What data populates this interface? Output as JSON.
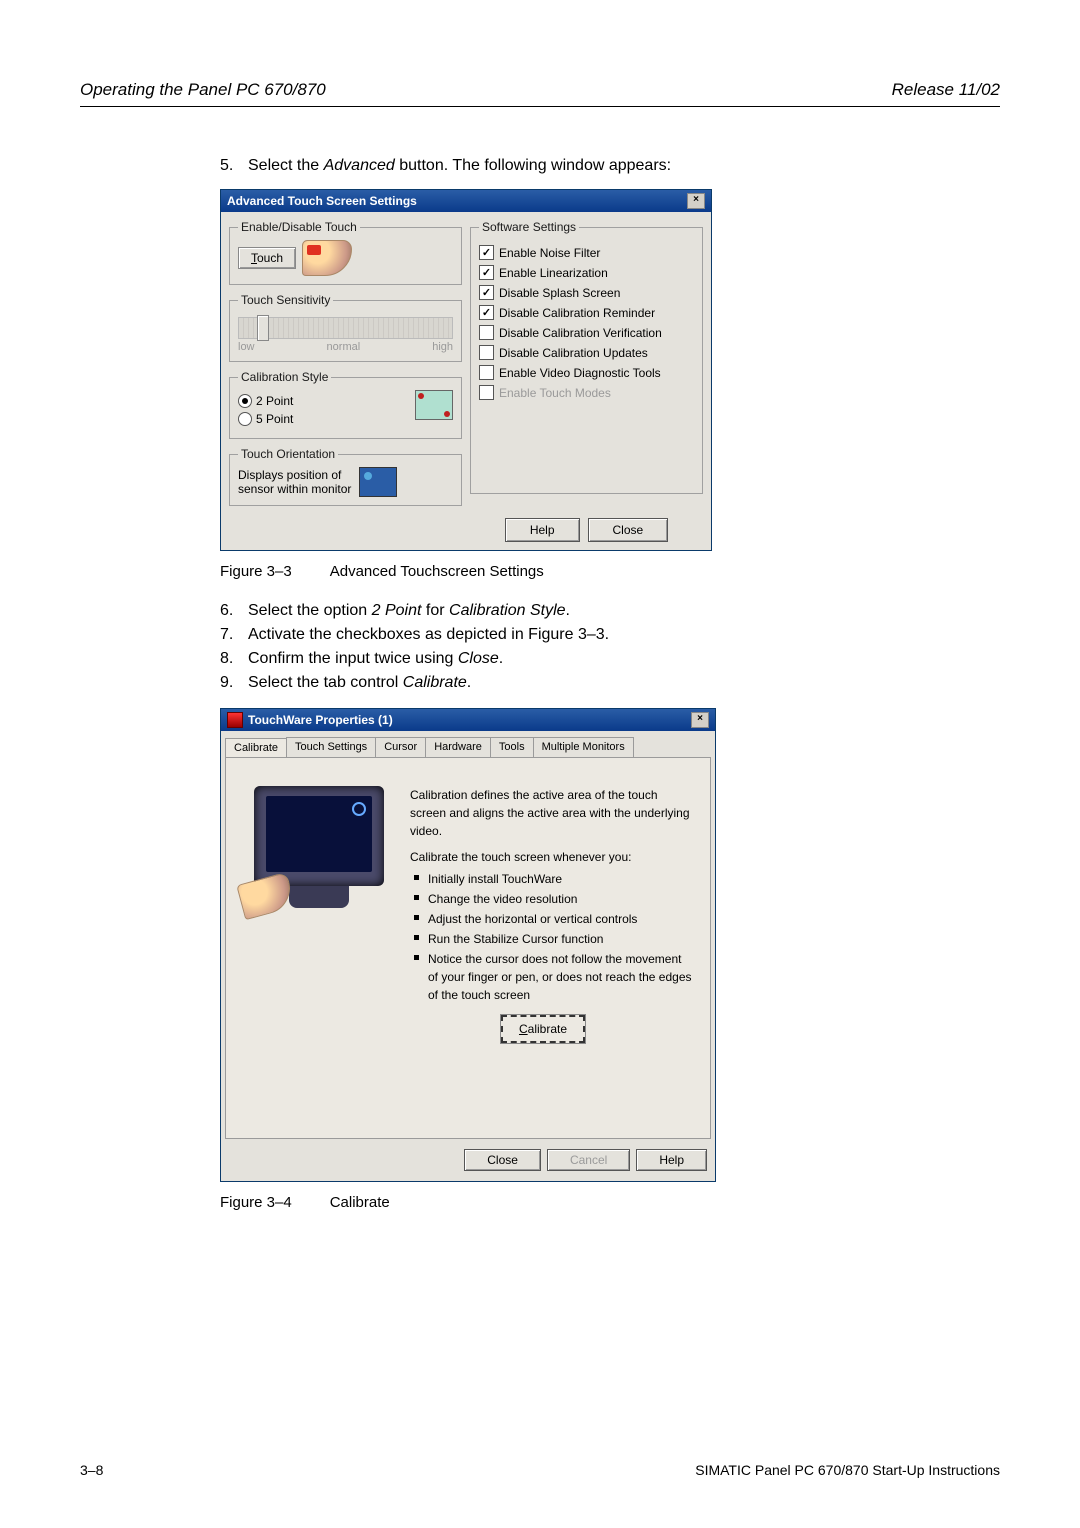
{
  "header": {
    "left": "Operating the Panel PC 670/870",
    "right": "Release 11/02"
  },
  "step5": {
    "num": "5.",
    "pre": "Select the ",
    "italic": "Advanced",
    "post": " button. The following window appears:"
  },
  "dlg1": {
    "title": "Advanced Touch Screen Settings",
    "x": "×",
    "enable_disable_legend": "Enable/Disable Touch",
    "touch_btn": "Touch",
    "sensitivity_legend": "Touch Sensitivity",
    "slider_low": "low",
    "slider_normal": "normal",
    "slider_high": "high",
    "cal_style_legend": "Calibration Style",
    "cal_2point": "2 Point",
    "cal_5point": "5 Point",
    "orientation_legend": "Touch Orientation",
    "orientation_text1": "Displays position of",
    "orientation_text2": "sensor within monitor",
    "soft_legend": "Software Settings",
    "soft": {
      "enable_noise": "Enable Noise Filter",
      "enable_linear": "Enable Linearization",
      "disable_splash": "Disable Splash Screen",
      "disable_reminder": "Disable Calibration Reminder",
      "disable_verif": "Disable Calibration Verification",
      "disable_updates": "Disable Calibration Updates",
      "enable_diag": "Enable Video Diagnostic Tools",
      "enable_touch_modes": "Enable Touch Modes"
    },
    "help": "Help",
    "close": "Close"
  },
  "fig3": {
    "label": "Figure 3–3",
    "caption": "Advanced Touchscreen Settings"
  },
  "step6": {
    "num": "6.",
    "pre": "Select the option ",
    "i1": "2 Point",
    "mid": " for ",
    "i2": "Calibration Style",
    "end": "."
  },
  "step7": {
    "num": "7.",
    "text": "Activate the checkboxes as depicted in Figure 3–3."
  },
  "step8": {
    "num": "8.",
    "pre": "Confirm the input twice using ",
    "i1": "Close",
    "end": "."
  },
  "step9": {
    "num": "9.",
    "pre": "Select the tab control ",
    "i1": "Calibrate",
    "end": "."
  },
  "dlg2": {
    "title": "TouchWare Properties (1)",
    "x": "×",
    "tabs": {
      "t0": "Calibrate",
      "t1": "Touch Settings",
      "t2": "Cursor",
      "t3": "Hardware",
      "t4": "Tools",
      "t5": "Multiple Monitors"
    },
    "desc_p1": "Calibration defines the active area of the touch screen and aligns the active area with the underlying video.",
    "desc_p2": "Calibrate the touch screen whenever you:",
    "bullets": {
      "b0": "Initially install TouchWare",
      "b1": "Change the video resolution",
      "b2": "Adjust the horizontal or vertical controls",
      "b3": "Run the Stabilize Cursor function",
      "b4": "Notice the cursor does not follow the movement of your finger or pen, or does not reach the edges of the touch screen"
    },
    "calibrate_btn": "Calibrate",
    "close": "Close",
    "cancel": "Cancel",
    "help": "Help"
  },
  "fig4": {
    "label": "Figure 3–4",
    "caption": "Calibrate"
  },
  "footer": {
    "left": "3–8",
    "right": "SIMATIC Panel PC 670/870 Start-Up Instructions"
  }
}
